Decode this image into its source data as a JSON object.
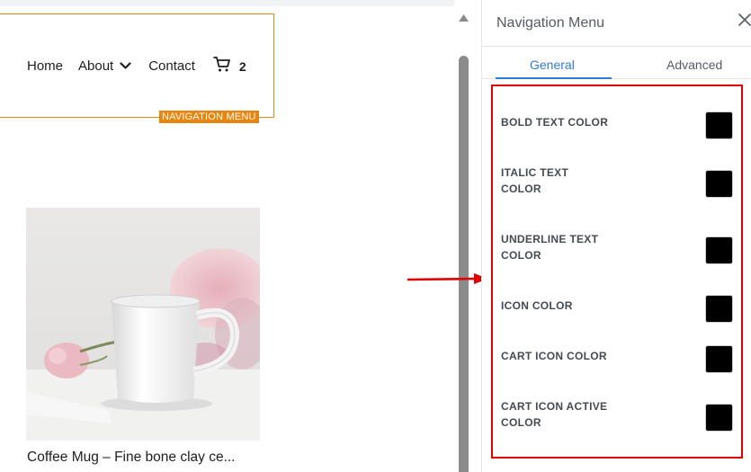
{
  "canvas": {
    "nav": {
      "items": [
        "Home",
        "About",
        "Contact"
      ],
      "cart_count": "2",
      "widget_tag": "NAVIGATION MENU"
    },
    "product": {
      "title": "Coffee Mug – Fine bone clay ce..."
    }
  },
  "panel": {
    "title": "Navigation Menu",
    "tabs": [
      {
        "label": "General",
        "active": true
      },
      {
        "label": "Advanced",
        "active": false
      }
    ],
    "settings": [
      {
        "label": "BOLD TEXT COLOR",
        "value": "#000000"
      },
      {
        "label": "ITALIC TEXT COLOR",
        "value": "#000000"
      },
      {
        "label": "UNDERLINE TEXT COLOR",
        "value": "#000000"
      },
      {
        "label": "ICON COLOR",
        "value": "#000000"
      },
      {
        "label": "CART ICON COLOR",
        "value": "#000000"
      },
      {
        "label": "CART ICON ACTIVE COLOR",
        "value": "#000000"
      }
    ]
  },
  "colors": {
    "accent": "#2f7bd6",
    "widget_outline": "#e8850f",
    "annotation": "#e00000"
  }
}
